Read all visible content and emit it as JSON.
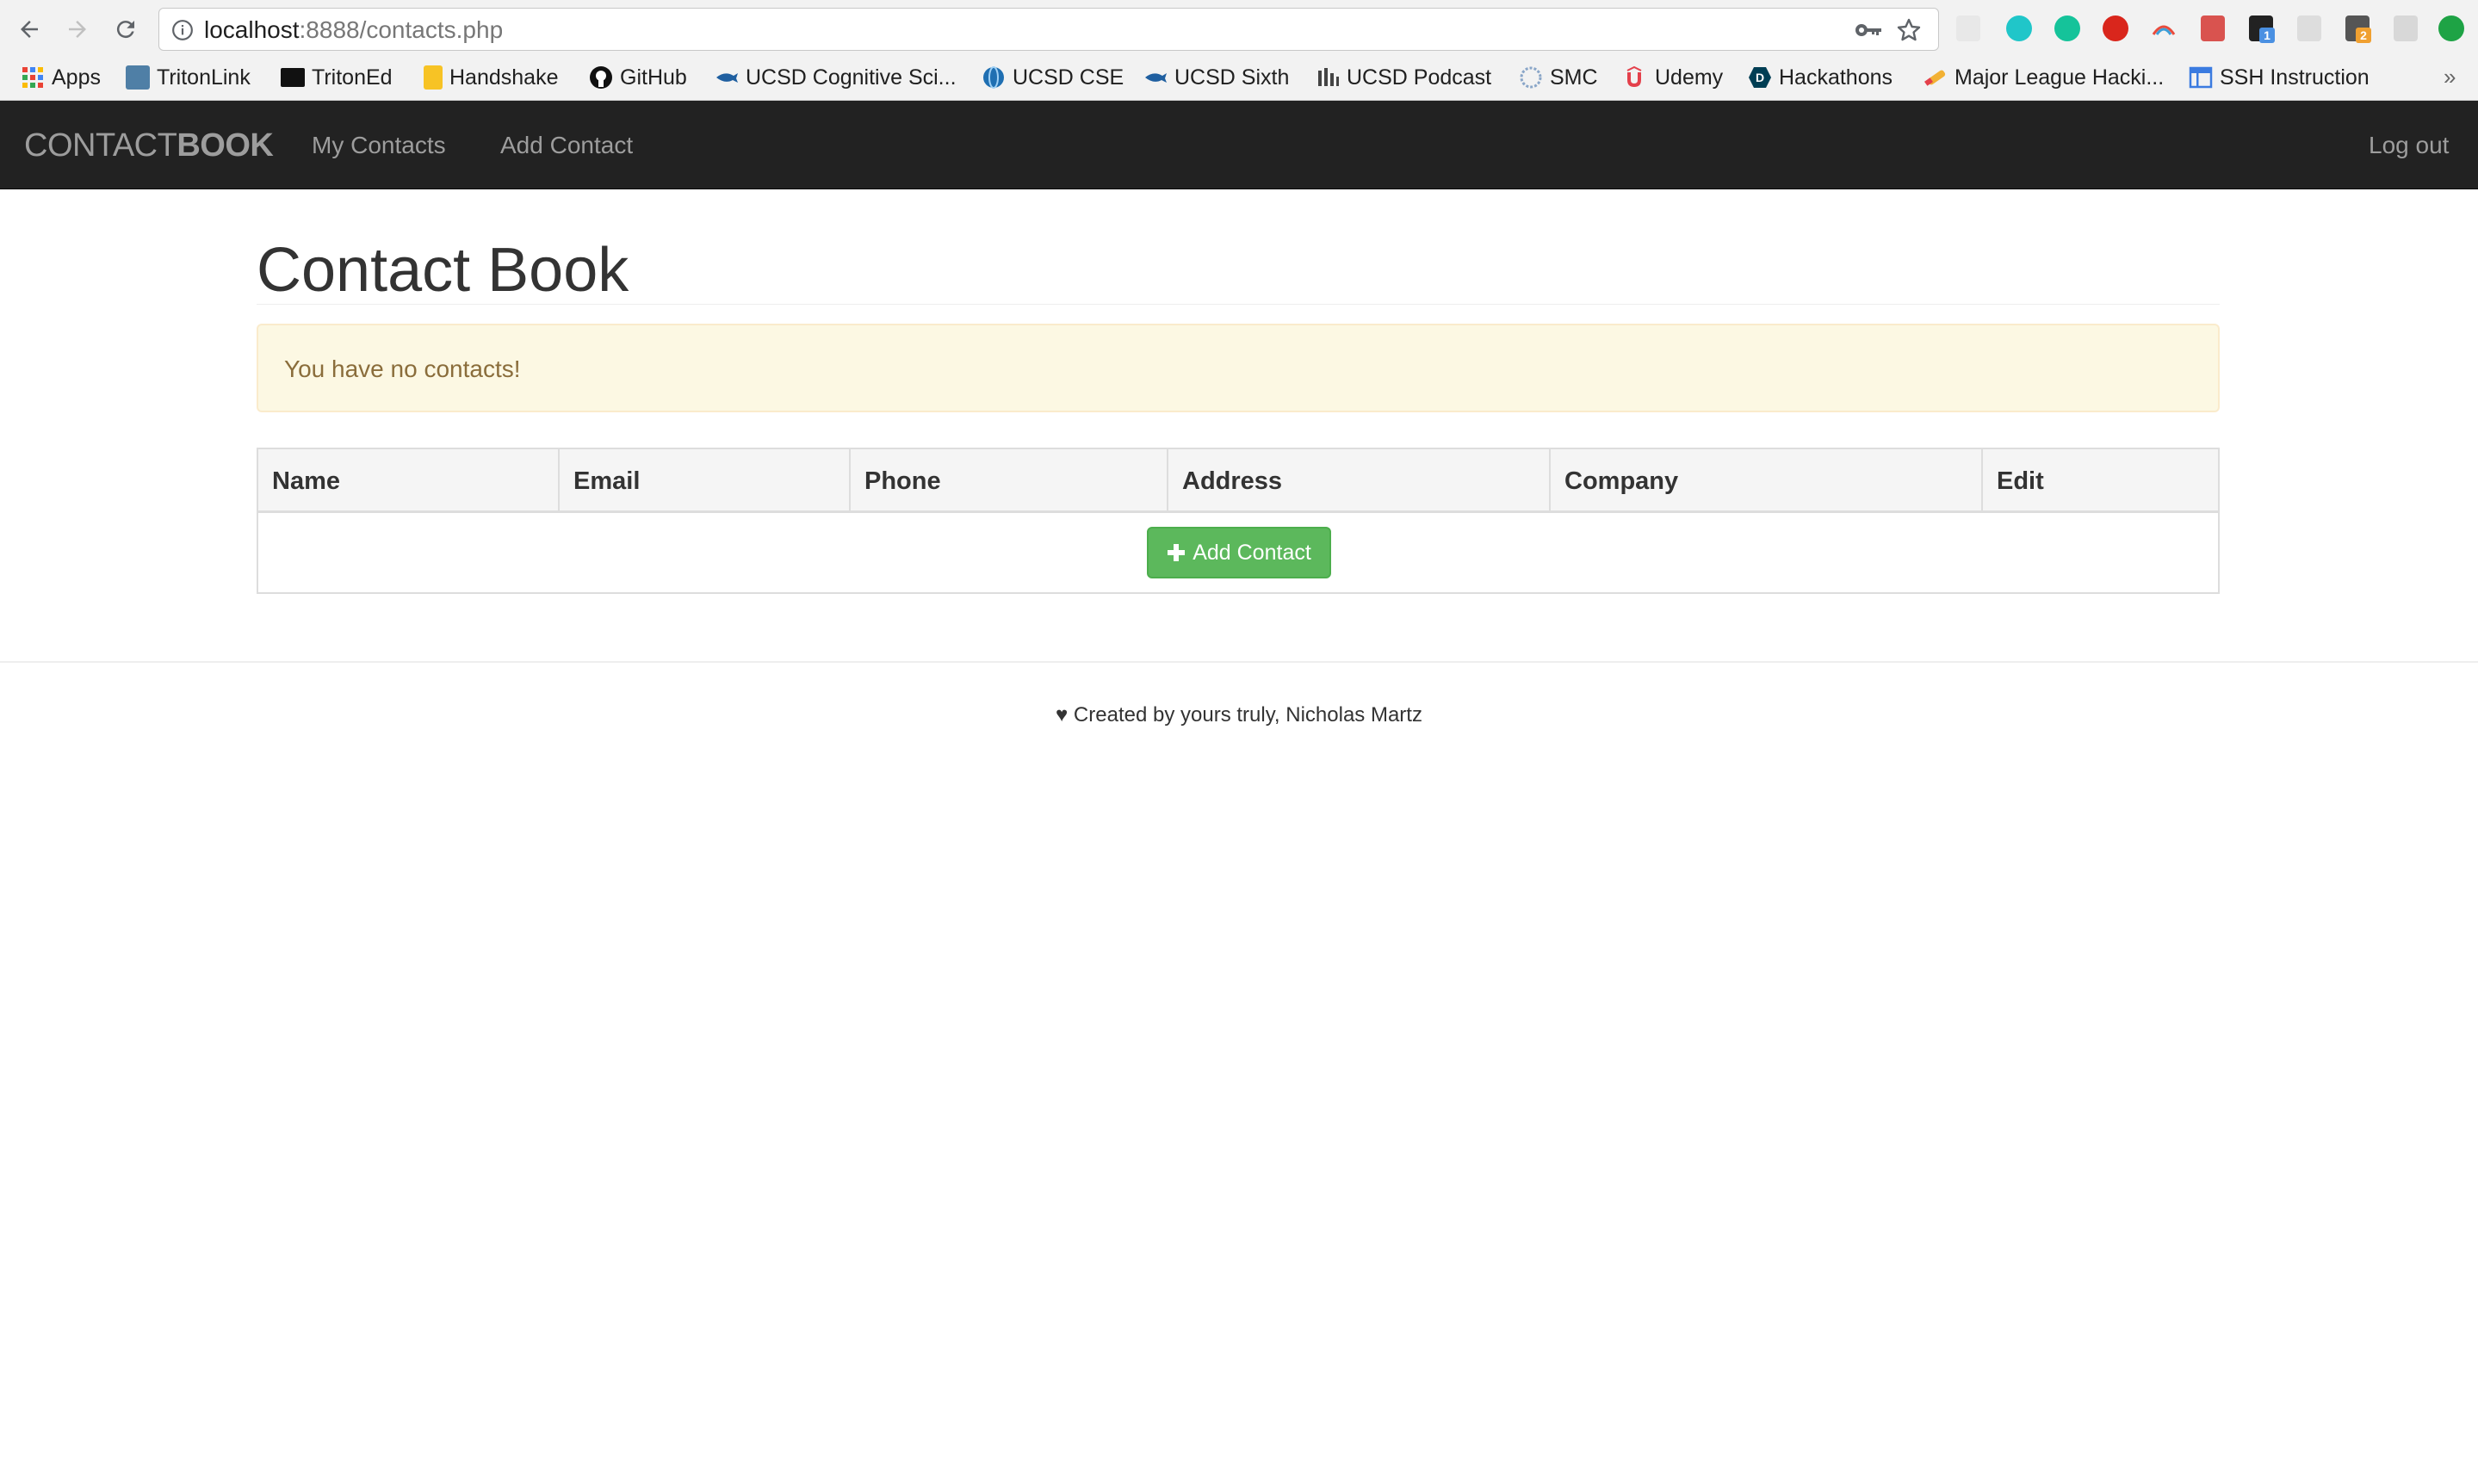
{
  "browser": {
    "url_host": "localhost",
    "url_rest": ":8888/contacts.php",
    "bookmarks": [
      {
        "label": "Apps",
        "icon": "apps-grid-icon"
      },
      {
        "label": "TritonLink",
        "icon": "tritonlink-icon"
      },
      {
        "label": "TritonEd",
        "icon": "blackboard-icon"
      },
      {
        "label": "Handshake",
        "icon": "handshake-icon"
      },
      {
        "label": "GitHub",
        "icon": "github-icon"
      },
      {
        "label": "UCSD Cognitive Sci...",
        "icon": "ucsd-fish-icon"
      },
      {
        "label": "UCSD CSE",
        "icon": "globe-icon"
      },
      {
        "label": "UCSD Sixth",
        "icon": "ucsd-fish-icon"
      },
      {
        "label": "UCSD Podcast",
        "icon": "podcast-icon"
      },
      {
        "label": "SMC",
        "icon": "smc-icon"
      },
      {
        "label": "Udemy",
        "icon": "udemy-icon"
      },
      {
        "label": "Hackathons",
        "icon": "devpost-icon"
      },
      {
        "label": "Major League Hacki...",
        "icon": "mlh-icon"
      },
      {
        "label": "SSH Instruction",
        "icon": "window-icon"
      }
    ],
    "more": "»"
  },
  "navbar": {
    "brand_light": "CONTACT",
    "brand_bold": "BOOK",
    "links": [
      "My Contacts",
      "Add Contact"
    ],
    "logout": "Log out"
  },
  "main": {
    "title": "Contact Book",
    "alert": "You have no contacts!",
    "columns": [
      "Name",
      "Email",
      "Phone",
      "Address",
      "Company",
      "Edit"
    ],
    "add_button": "Add Contact"
  },
  "footer": {
    "text": "♥ Created by yours truly, Nicholas Martz"
  },
  "colors": {
    "navbar_bg": "#222222",
    "alert_bg": "#fcf8e3",
    "alert_text": "#8a6d3b",
    "success": "#5cb85c"
  }
}
